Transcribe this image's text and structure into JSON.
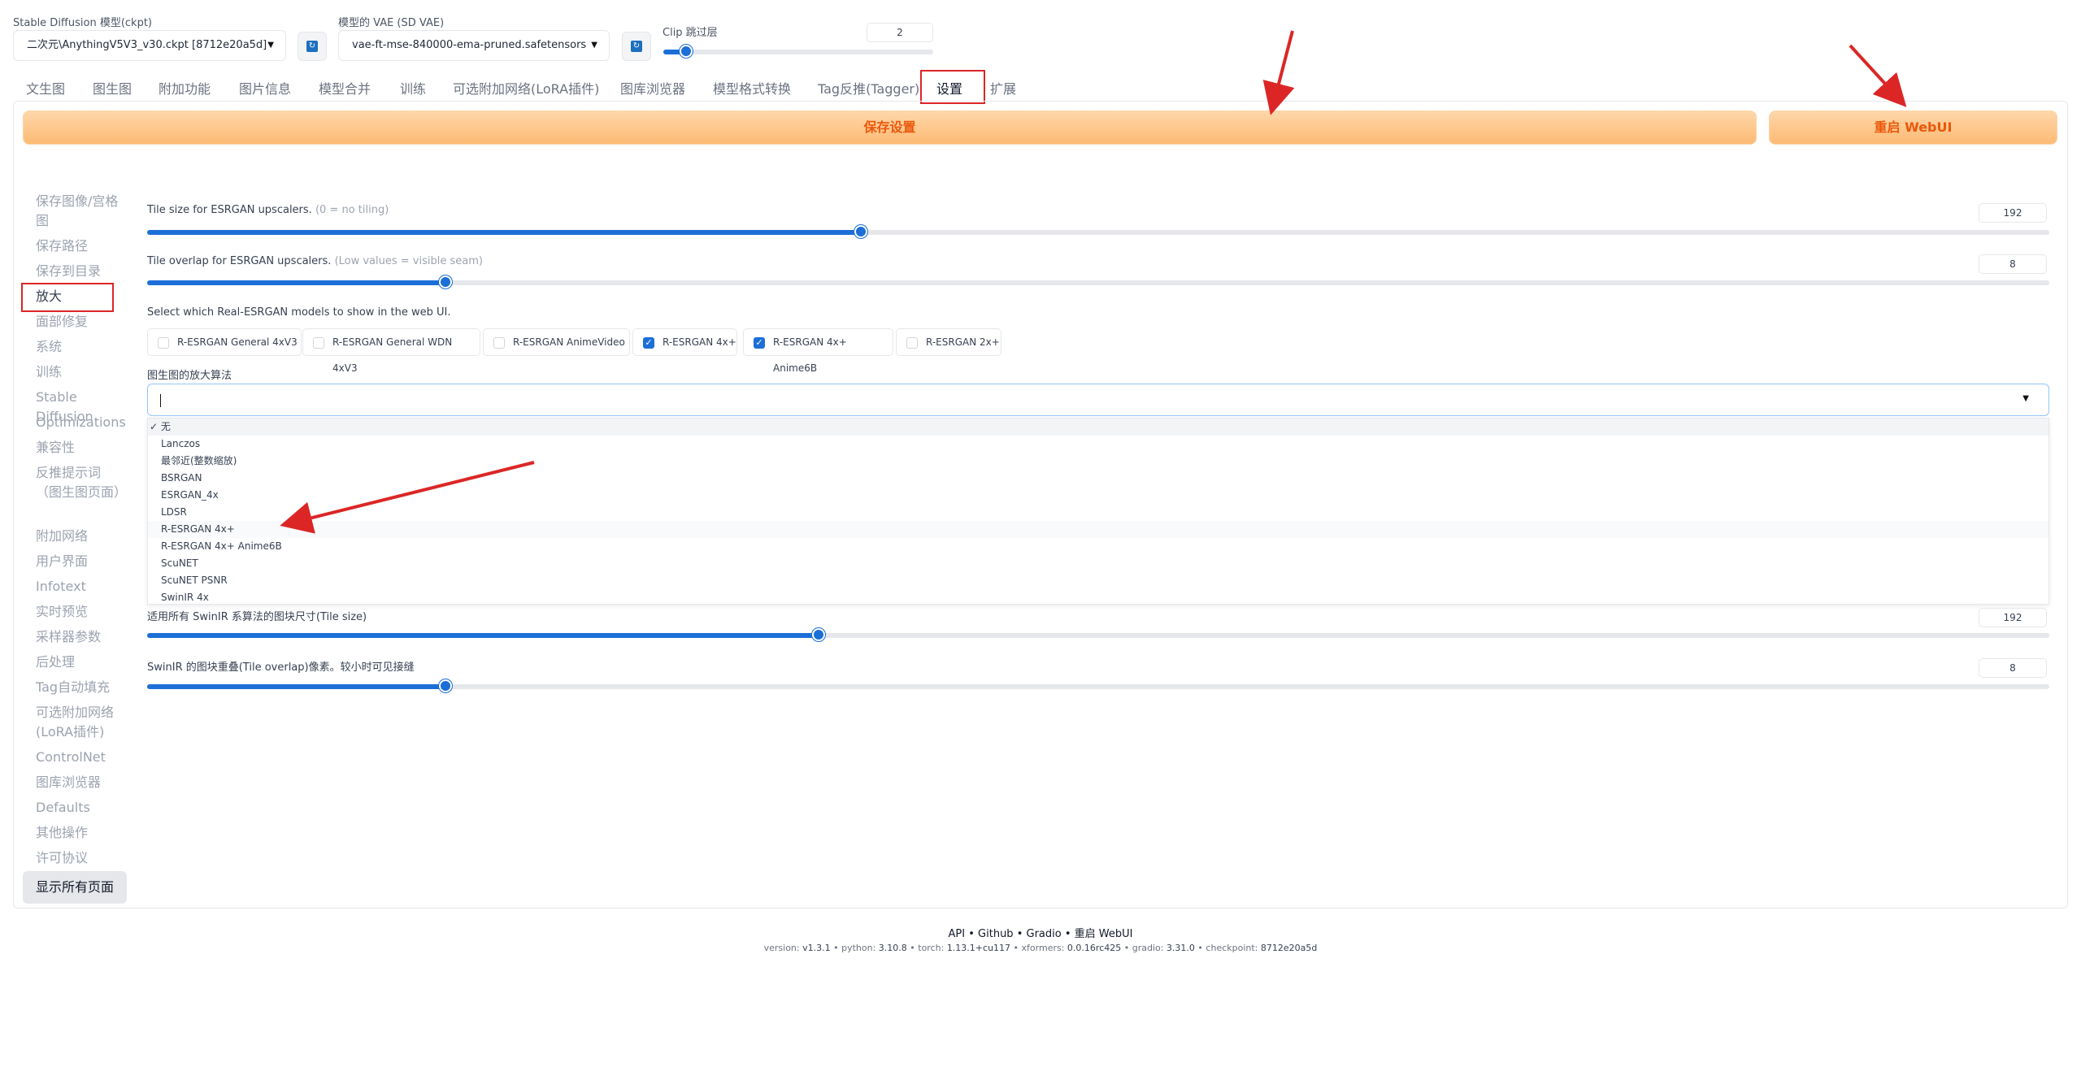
{
  "top": {
    "model_label": "Stable Diffusion 模型(ckpt)",
    "model_value": "二次元\\AnythingV5V3_v30.ckpt [8712e20a5d]",
    "vae_label": "模型的 VAE (SD VAE)",
    "vae_value": "vae-ft-mse-840000-ema-pruned.safetensors",
    "clip_label": "Clip 跳过层",
    "clip_value": "2",
    "clip_level": 0.083
  },
  "tabs": [
    "文生图",
    "图生图",
    "附加功能",
    "图片信息",
    "模型合并",
    "训练",
    "可选附加网络(LoRA插件)",
    "图库浏览器",
    "模型格式转换",
    "Tag反推(Tagger)",
    "设置",
    "扩展"
  ],
  "active_tab": "设置",
  "buttons": {
    "save": "保存设置",
    "restart": "重启 WebUI"
  },
  "sidebar": {
    "items": [
      "保存图像/宫格图",
      "保存路径",
      "保存到目录",
      "放大",
      "面部修复",
      "系统",
      "训练",
      "Stable Diffusion",
      "Optimizations",
      "兼容性",
      "反推提示词（图生图页面）",
      "附加网络",
      "用户界面",
      "Infotext",
      "实时预览",
      "采样器参数",
      "后处理",
      "Tag自动填充",
      "可选附加网络(LoRA插件)",
      "ControlNet",
      "图库浏览器",
      "Defaults",
      "其他操作",
      "许可协议"
    ],
    "active": "放大",
    "show_all": "显示所有页面"
  },
  "settings": {
    "esrgan_tile_label": "Tile size for ESRGAN upscalers.",
    "esrgan_tile_hint": "(0 = no tiling)",
    "esrgan_tile_value": "192",
    "esrgan_tile_level": 0.375,
    "esrgan_overlap_label": "Tile overlap for ESRGAN upscalers.",
    "esrgan_overlap_hint": "(Low values = visible seam)",
    "esrgan_overlap_value": "8",
    "esrgan_overlap_level": 0.157,
    "realesrgan_label": "Select which Real-ESRGAN models to show in the web UI.",
    "realesrgan_models": [
      {
        "label": "R-ESRGAN General 4xV3",
        "checked": false
      },
      {
        "label": "R-ESRGAN General WDN 4xV3",
        "checked": false
      },
      {
        "label": "R-ESRGAN AnimeVideo",
        "checked": false
      },
      {
        "label": "R-ESRGAN 4x+",
        "checked": true
      },
      {
        "label": "R-ESRGAN 4x+ Anime6B",
        "checked": true
      },
      {
        "label": "R-ESRGAN 2x+",
        "checked": false
      }
    ],
    "img2img_upscaler_label": "图生图的放大算法",
    "upscaler_options": [
      "✓ 无",
      "Lanczos",
      "最邻近(整数缩放)",
      "BSRGAN",
      "ESRGAN_4x",
      "LDSR",
      "R-ESRGAN 4x+",
      "R-ESRGAN 4x+ Anime6B",
      "ScuNET",
      "ScuNET PSNR",
      "SwinIR 4x"
    ],
    "swinir_tile_label": "适用所有 SwinIR 系算法的图块尺寸(Tile size)",
    "swinir_tile_value": "192",
    "swinir_tile_level": 0.353,
    "swinir_overlap_label": "SwinIR 的图块重叠(Tile overlap)像素。较小时可见接缝",
    "swinir_overlap_value": "8",
    "swinir_overlap_level": 0.157
  },
  "footer": {
    "links": [
      "API",
      "Github",
      "Gradio",
      "重启 WebUI"
    ],
    "separator": " • ",
    "version_items": [
      {
        "k": "version: ",
        "v": "v1.3.1"
      },
      {
        "k": "python: ",
        "v": "3.10.8"
      },
      {
        "k": "torch: ",
        "v": "1.13.1+cu117"
      },
      {
        "k": "xformers: ",
        "v": "0.0.16rc425"
      },
      {
        "k": "gradio: ",
        "v": "3.31.0"
      },
      {
        "k": "checkpoint: ",
        "v": "8712e20a5d"
      }
    ]
  },
  "colors": {
    "accent": "#1c6fd6",
    "annotation": "#dc2626",
    "primary_button": "#fdba74"
  }
}
